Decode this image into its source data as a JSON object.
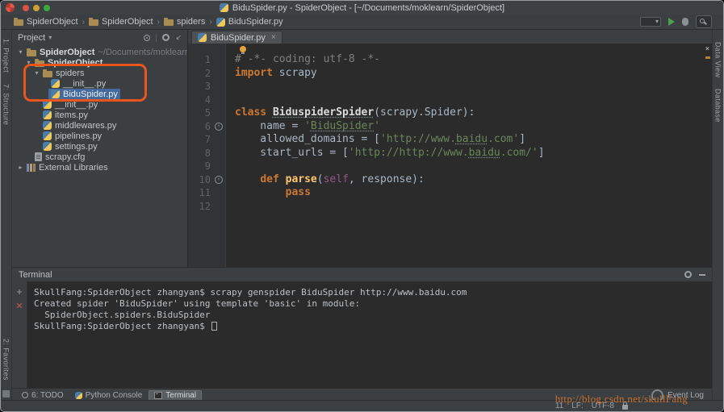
{
  "window": {
    "title": "BiduSpider.py - SpiderObject - [~/Documents/moklearn/SpiderObject]"
  },
  "breadcrumbs": [
    {
      "label": "SpiderObject",
      "icon": "folder"
    },
    {
      "label": "SpiderObject",
      "icon": "folder"
    },
    {
      "label": "spiders",
      "icon": "folder"
    },
    {
      "label": "BiduSpider.py",
      "icon": "python-file"
    }
  ],
  "left_stripe": {
    "top": [
      "1: Project",
      "7: Structure"
    ],
    "bottom": [
      "2: Favorites"
    ]
  },
  "right_stripe": [
    "Data View",
    "Database"
  ],
  "project_panel": {
    "title": "Project",
    "tree": [
      {
        "label": "SpiderObject",
        "suffix": " ~/Documents/moklearn/Spide",
        "icon": "folder",
        "arrow": "expanded",
        "depth": 0,
        "bold": true
      },
      {
        "label": "SpiderObject",
        "icon": "folder",
        "arrow": "expanded",
        "depth": 1,
        "bold": true
      },
      {
        "label": "spiders",
        "icon": "folder",
        "arrow": "expanded",
        "depth": 2
      },
      {
        "label": "__init__.py",
        "icon": "python",
        "depth": 3
      },
      {
        "label": "BiduSpider.py",
        "icon": "python",
        "depth": 3,
        "selected": true
      },
      {
        "label": "__init__.py",
        "icon": "python",
        "depth": 2
      },
      {
        "label": "items.py",
        "icon": "python",
        "depth": 2
      },
      {
        "label": "middlewares.py",
        "icon": "python",
        "depth": 2
      },
      {
        "label": "pipelines.py",
        "icon": "python",
        "depth": 2
      },
      {
        "label": "settings.py",
        "icon": "python",
        "depth": 2
      },
      {
        "label": "scrapy.cfg",
        "icon": "config-file",
        "depth": 1
      },
      {
        "label": "External Libraries",
        "icon": "library",
        "arrow": "collapsed",
        "depth": 0
      }
    ]
  },
  "editor": {
    "tab_label": "BiduSpider.py",
    "code_lines": [
      {
        "n": 1,
        "tokens": [
          [
            "# -*- coding: utf-8 -*-",
            "cm"
          ]
        ]
      },
      {
        "n": 2,
        "tokens": [
          [
            "import",
            "kw"
          ],
          [
            " scrapy",
            "pl"
          ]
        ]
      },
      {
        "n": 3,
        "tokens": []
      },
      {
        "n": 4,
        "tokens": []
      },
      {
        "n": 5,
        "tokens": [
          [
            "class ",
            "kw"
          ],
          [
            "BiduspiderSpider",
            "cl un"
          ],
          [
            "(scrapy.Spider):",
            "pl"
          ]
        ]
      },
      {
        "n": 6,
        "mark": true,
        "tokens": [
          [
            "    name = ",
            "pl"
          ],
          [
            "'",
            "st"
          ],
          [
            "BiduSpider",
            "st un"
          ],
          [
            "'",
            "st"
          ]
        ]
      },
      {
        "n": 7,
        "tokens": [
          [
            "    allowed_domains = [",
            "pl"
          ],
          [
            "'http://www.",
            "st"
          ],
          [
            "baidu",
            "st un"
          ],
          [
            ".com'",
            "st"
          ],
          [
            "]",
            "pl"
          ]
        ]
      },
      {
        "n": 8,
        "tokens": [
          [
            "    start_urls = [",
            "pl"
          ],
          [
            "'http://http://www.",
            "st"
          ],
          [
            "baidu",
            "st un"
          ],
          [
            ".com/'",
            "st"
          ],
          [
            "]",
            "pl"
          ]
        ]
      },
      {
        "n": 9,
        "tokens": []
      },
      {
        "n": 10,
        "mark": true,
        "tokens": [
          [
            "    ",
            "pl"
          ],
          [
            "def ",
            "kw"
          ],
          [
            "parse",
            "fn"
          ],
          [
            "(",
            "pl"
          ],
          [
            "self",
            "sf"
          ],
          [
            ", response):",
            "pl"
          ]
        ]
      },
      {
        "n": 11,
        "tokens": [
          [
            "        ",
            "pl"
          ],
          [
            "pass",
            "kw"
          ]
        ]
      },
      {
        "n": 12,
        "tokens": []
      }
    ]
  },
  "terminal": {
    "title": "Terminal",
    "lines": [
      "SkullFang:SpiderObject zhangyan$ scrapy genspider BiduSpider http://www.baidu.com",
      "Created spider 'BiduSpider' using template 'basic' in module:",
      "  SpiderObject.spiders.BiduSpider",
      "SkullFang:SpiderObject zhangyan$ "
    ]
  },
  "bottom_bar": {
    "tabs": [
      {
        "label": "6: TODO",
        "icon": "todo"
      },
      {
        "label": "Python Console",
        "icon": "python"
      },
      {
        "label": "Terminal",
        "icon": "terminal",
        "active": true
      }
    ],
    "event_log_label": "Event Log"
  },
  "status_bar": {
    "items": [
      "11",
      "LF:",
      "UTF-8"
    ]
  },
  "watermark": "http://blog.csdn.net/skullFang",
  "colors": {
    "keyword": "#cc7832",
    "string": "#6a8759",
    "comment": "#808080",
    "annotation": "#e8561e",
    "selection": "#44699d",
    "watermark": "#c9722e"
  }
}
